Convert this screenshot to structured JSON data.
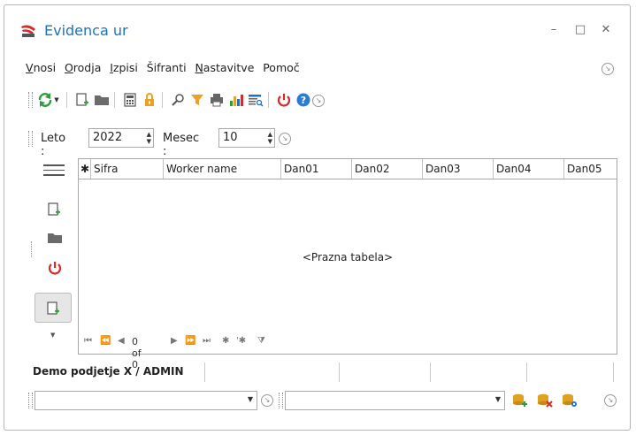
{
  "window": {
    "title": "Evidenca ur",
    "minimize_glyph": "–",
    "maximize_glyph": "□",
    "close_glyph": "✕"
  },
  "menu": {
    "items": [
      {
        "label": "Vnosi",
        "underline": "V",
        "rest": "nosi"
      },
      {
        "label": "Orodja",
        "underline": "O",
        "rest": "rodja"
      },
      {
        "label": "Izpisi",
        "underline": "I",
        "rest": "zpisi"
      },
      {
        "label": "Šifranti",
        "underline": "",
        "rest": "Šifranti"
      },
      {
        "label": "Nastavitve",
        "underline": "N",
        "rest": "astavitve"
      },
      {
        "label": "Pomoč",
        "underline": "",
        "rest": "Pomoč"
      }
    ]
  },
  "toolbar": {
    "icons": [
      "refresh-icon",
      "new-document-icon",
      "folder-icon",
      "calculator-icon",
      "lock-icon",
      "search-icon",
      "filter-icon",
      "print-icon",
      "bar-chart-icon",
      "report-search-icon",
      "power-icon",
      "help-icon"
    ]
  },
  "filter": {
    "year_label": "Leto :",
    "year_value": "2022",
    "month_label": "Mesec :",
    "month_value": "10"
  },
  "grid": {
    "columns": [
      "Sifra",
      "Worker name",
      "Dan01",
      "Dan02",
      "Dan03",
      "Dan04",
      "Dan05"
    ],
    "empty_text": "<Prazna tabela>",
    "record_info": "0 of 0"
  },
  "status": {
    "user_text": "Demo podjetje X / ADMIN"
  },
  "colors": {
    "title": "#1a73c9",
    "accent_green": "#2e9e3a",
    "accent_red": "#d62b2b",
    "accent_orange": "#f0a020"
  }
}
